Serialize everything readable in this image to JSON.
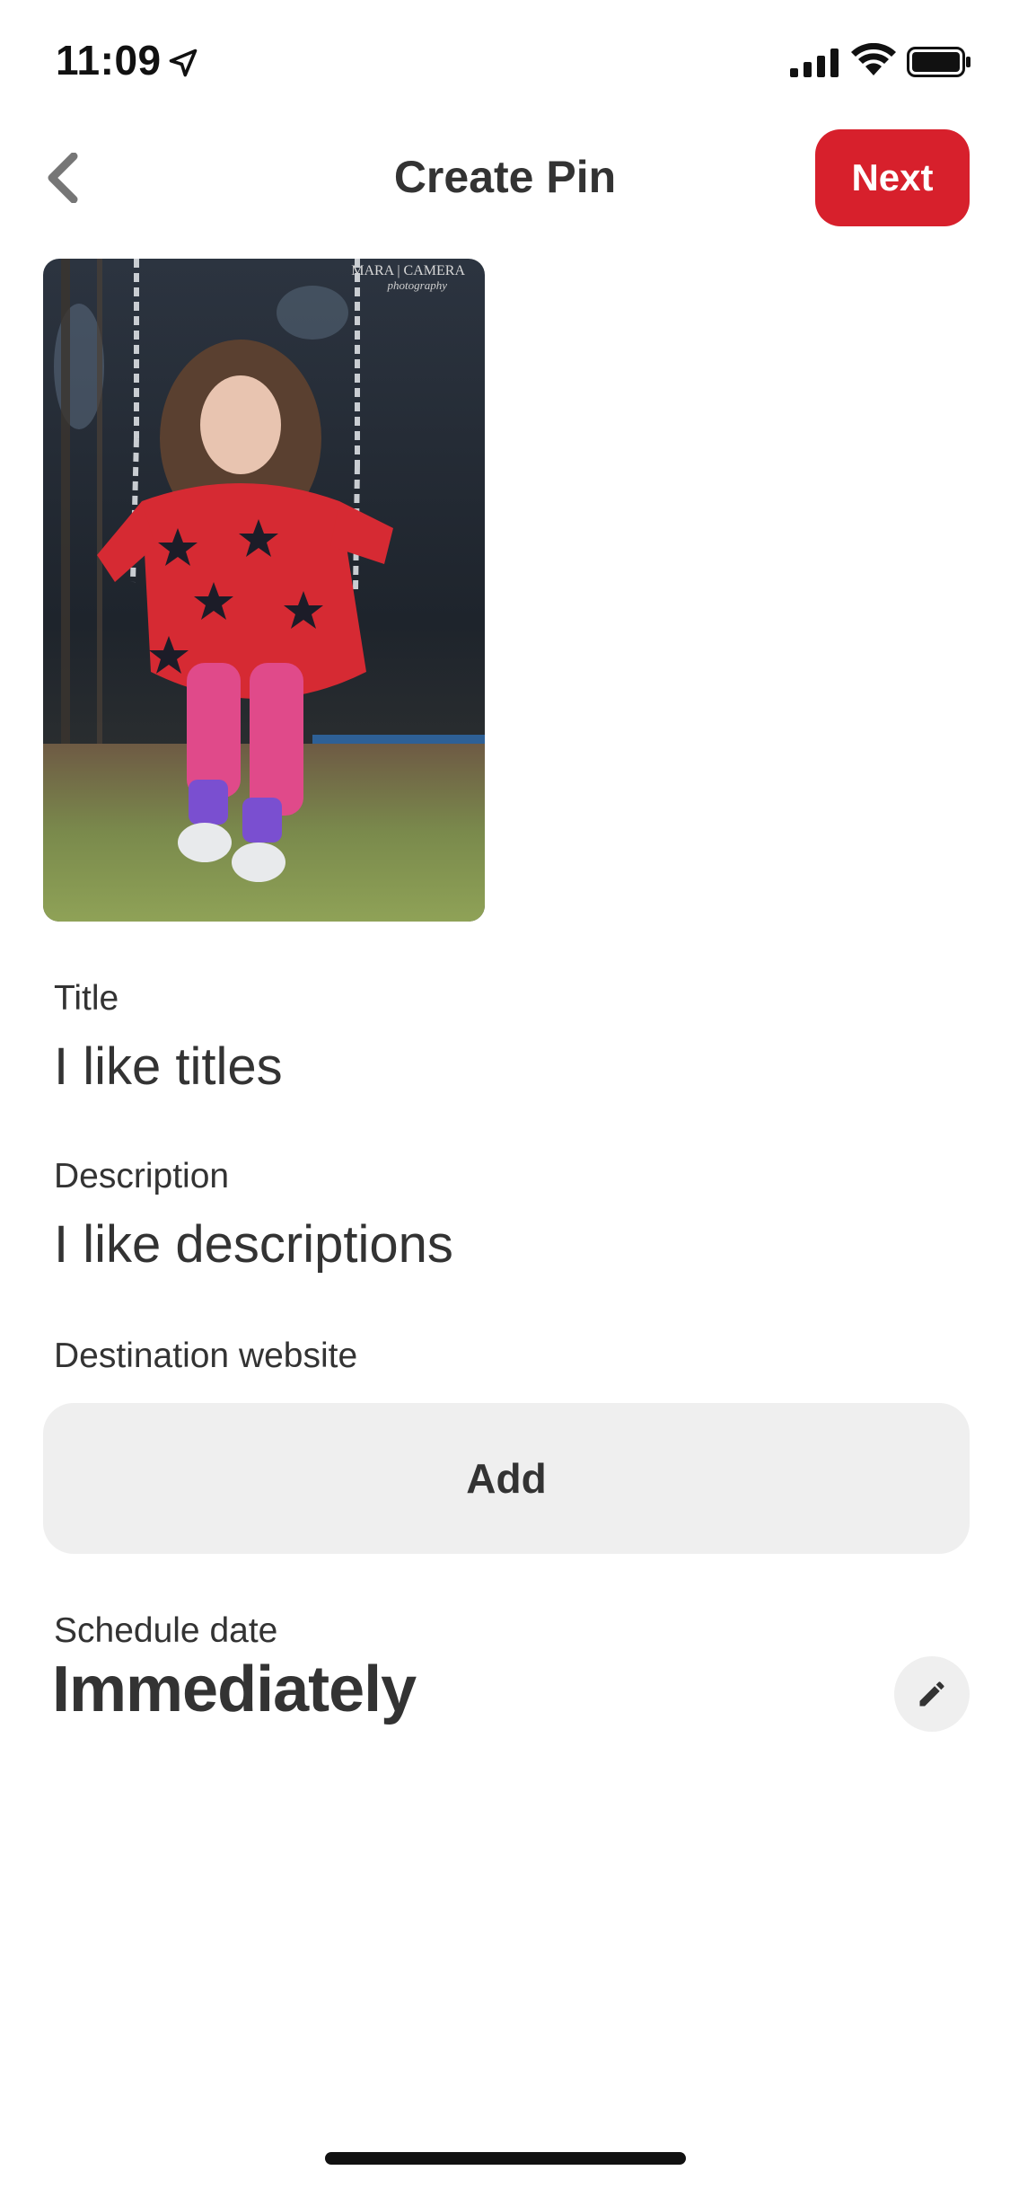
{
  "status_bar": {
    "time": "11:09",
    "icons": [
      "location-arrow-icon",
      "cellular-signal-icon",
      "wifi-icon",
      "battery-icon"
    ]
  },
  "header": {
    "title": "Create Pin",
    "back_icon": "chevron-left-icon",
    "next_label": "Next"
  },
  "pin_image": {
    "watermark_line1": "MARA | CAMERA",
    "watermark_line2": "photography"
  },
  "form": {
    "title_label": "Title",
    "title_value": "I like titles",
    "description_label": "Description",
    "description_value": "I like descriptions",
    "destination_label": "Destination website",
    "destination_button": "Add",
    "schedule_label": "Schedule date",
    "schedule_value": "Immediately",
    "schedule_edit_icon": "pencil-icon"
  },
  "colors": {
    "accent": "#d7202c",
    "text": "#333333",
    "field_bg": "#efefef"
  }
}
